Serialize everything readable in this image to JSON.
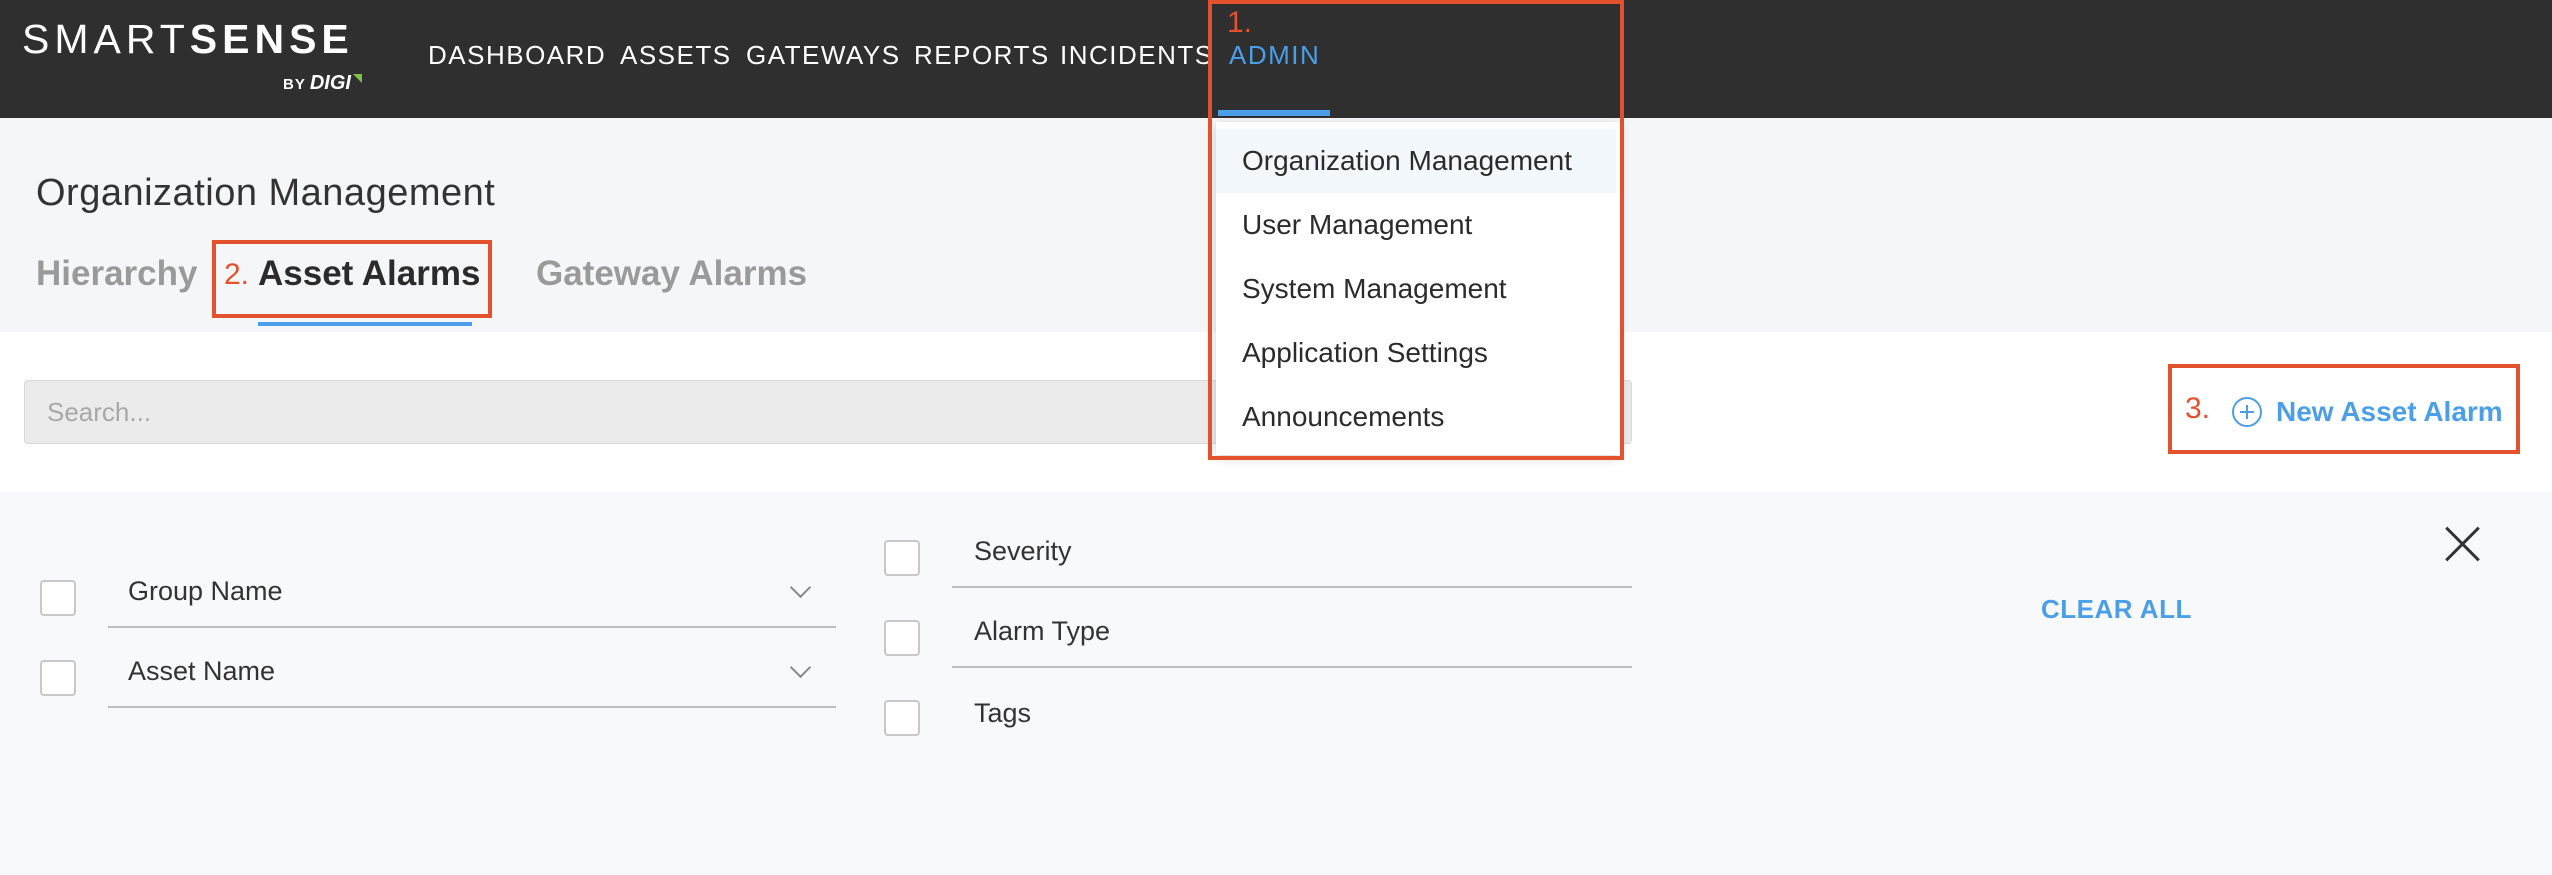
{
  "brand": {
    "name_light": "SMART",
    "name_bold": "SENSE",
    "sub_by": "BY",
    "sub_digi": "DIGI"
  },
  "nav": {
    "items": [
      "DASHBOARD",
      "ASSETS",
      "GATEWAYS",
      "REPORTS",
      "INCIDENTS"
    ],
    "active_item": "ADMIN"
  },
  "admin_menu": {
    "items": [
      "Organization Management",
      "User Management",
      "System Management",
      "Application Settings",
      "Announcements"
    ]
  },
  "page": {
    "title": "Organization Management",
    "tabs": [
      "Hierarchy",
      "Asset Alarms",
      "Gateway Alarms"
    ],
    "active_tab": "Asset Alarms"
  },
  "toolbar": {
    "search_placeholder": "Search...",
    "new_alarm_label": "New Asset Alarm"
  },
  "filters": {
    "group_name": "Group Name",
    "asset_name": "Asset Name",
    "severity": "Severity",
    "alarm_type": "Alarm Type",
    "tags": "Tags",
    "clear_all": "CLEAR ALL"
  },
  "annotations": {
    "step1": "1.",
    "step2": "2.",
    "step3": "3."
  },
  "colors": {
    "accent": "#4a9fe8",
    "navbar": "#2f2f30",
    "annotation": "#e4512d"
  }
}
